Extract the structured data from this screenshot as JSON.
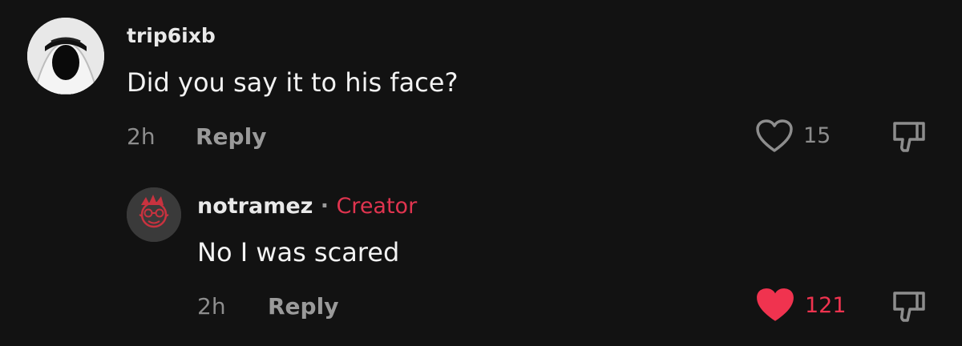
{
  "comments": [
    {
      "username": "trip6ixb",
      "text": "Did you say it to his face?",
      "time": "2h",
      "reply_label": "Reply",
      "likes": "15",
      "liked": false
    },
    {
      "username": "notramez",
      "separator": "·",
      "badge": "Creator",
      "text": "No I was scared",
      "time": "2h",
      "reply_label": "Reply",
      "likes": "121",
      "liked": true
    }
  ],
  "colors": {
    "background": "#121212",
    "creator_badge": "#e0344f",
    "liked_heart": "#f0334f",
    "muted_text": "#8d8d8d"
  },
  "icons": {
    "like": "heart-outline-icon",
    "liked": "heart-filled-icon",
    "dislike": "thumbs-down-icon"
  }
}
